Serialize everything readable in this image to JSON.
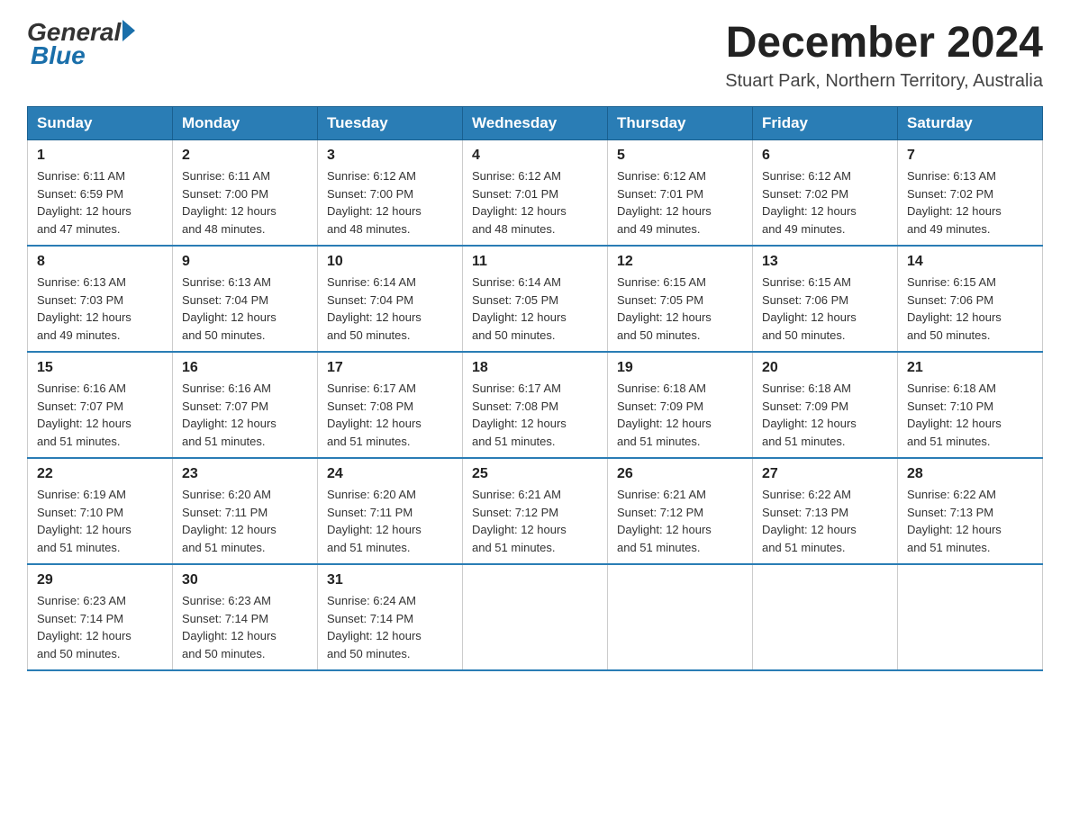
{
  "logo": {
    "general": "General",
    "blue": "Blue"
  },
  "title": "December 2024",
  "subtitle": "Stuart Park, Northern Territory, Australia",
  "days_of_week": [
    "Sunday",
    "Monday",
    "Tuesday",
    "Wednesday",
    "Thursday",
    "Friday",
    "Saturday"
  ],
  "weeks": [
    [
      {
        "day": "1",
        "sunrise": "6:11 AM",
        "sunset": "6:59 PM",
        "daylight": "12 hours and 47 minutes."
      },
      {
        "day": "2",
        "sunrise": "6:11 AM",
        "sunset": "7:00 PM",
        "daylight": "12 hours and 48 minutes."
      },
      {
        "day": "3",
        "sunrise": "6:12 AM",
        "sunset": "7:00 PM",
        "daylight": "12 hours and 48 minutes."
      },
      {
        "day": "4",
        "sunrise": "6:12 AM",
        "sunset": "7:01 PM",
        "daylight": "12 hours and 48 minutes."
      },
      {
        "day": "5",
        "sunrise": "6:12 AM",
        "sunset": "7:01 PM",
        "daylight": "12 hours and 49 minutes."
      },
      {
        "day": "6",
        "sunrise": "6:12 AM",
        "sunset": "7:02 PM",
        "daylight": "12 hours and 49 minutes."
      },
      {
        "day": "7",
        "sunrise": "6:13 AM",
        "sunset": "7:02 PM",
        "daylight": "12 hours and 49 minutes."
      }
    ],
    [
      {
        "day": "8",
        "sunrise": "6:13 AM",
        "sunset": "7:03 PM",
        "daylight": "12 hours and 49 minutes."
      },
      {
        "day": "9",
        "sunrise": "6:13 AM",
        "sunset": "7:04 PM",
        "daylight": "12 hours and 50 minutes."
      },
      {
        "day": "10",
        "sunrise": "6:14 AM",
        "sunset": "7:04 PM",
        "daylight": "12 hours and 50 minutes."
      },
      {
        "day": "11",
        "sunrise": "6:14 AM",
        "sunset": "7:05 PM",
        "daylight": "12 hours and 50 minutes."
      },
      {
        "day": "12",
        "sunrise": "6:15 AM",
        "sunset": "7:05 PM",
        "daylight": "12 hours and 50 minutes."
      },
      {
        "day": "13",
        "sunrise": "6:15 AM",
        "sunset": "7:06 PM",
        "daylight": "12 hours and 50 minutes."
      },
      {
        "day": "14",
        "sunrise": "6:15 AM",
        "sunset": "7:06 PM",
        "daylight": "12 hours and 50 minutes."
      }
    ],
    [
      {
        "day": "15",
        "sunrise": "6:16 AM",
        "sunset": "7:07 PM",
        "daylight": "12 hours and 51 minutes."
      },
      {
        "day": "16",
        "sunrise": "6:16 AM",
        "sunset": "7:07 PM",
        "daylight": "12 hours and 51 minutes."
      },
      {
        "day": "17",
        "sunrise": "6:17 AM",
        "sunset": "7:08 PM",
        "daylight": "12 hours and 51 minutes."
      },
      {
        "day": "18",
        "sunrise": "6:17 AM",
        "sunset": "7:08 PM",
        "daylight": "12 hours and 51 minutes."
      },
      {
        "day": "19",
        "sunrise": "6:18 AM",
        "sunset": "7:09 PM",
        "daylight": "12 hours and 51 minutes."
      },
      {
        "day": "20",
        "sunrise": "6:18 AM",
        "sunset": "7:09 PM",
        "daylight": "12 hours and 51 minutes."
      },
      {
        "day": "21",
        "sunrise": "6:18 AM",
        "sunset": "7:10 PM",
        "daylight": "12 hours and 51 minutes."
      }
    ],
    [
      {
        "day": "22",
        "sunrise": "6:19 AM",
        "sunset": "7:10 PM",
        "daylight": "12 hours and 51 minutes."
      },
      {
        "day": "23",
        "sunrise": "6:20 AM",
        "sunset": "7:11 PM",
        "daylight": "12 hours and 51 minutes."
      },
      {
        "day": "24",
        "sunrise": "6:20 AM",
        "sunset": "7:11 PM",
        "daylight": "12 hours and 51 minutes."
      },
      {
        "day": "25",
        "sunrise": "6:21 AM",
        "sunset": "7:12 PM",
        "daylight": "12 hours and 51 minutes."
      },
      {
        "day": "26",
        "sunrise": "6:21 AM",
        "sunset": "7:12 PM",
        "daylight": "12 hours and 51 minutes."
      },
      {
        "day": "27",
        "sunrise": "6:22 AM",
        "sunset": "7:13 PM",
        "daylight": "12 hours and 51 minutes."
      },
      {
        "day": "28",
        "sunrise": "6:22 AM",
        "sunset": "7:13 PM",
        "daylight": "12 hours and 51 minutes."
      }
    ],
    [
      {
        "day": "29",
        "sunrise": "6:23 AM",
        "sunset": "7:14 PM",
        "daylight": "12 hours and 50 minutes."
      },
      {
        "day": "30",
        "sunrise": "6:23 AM",
        "sunset": "7:14 PM",
        "daylight": "12 hours and 50 minutes."
      },
      {
        "day": "31",
        "sunrise": "6:24 AM",
        "sunset": "7:14 PM",
        "daylight": "12 hours and 50 minutes."
      },
      null,
      null,
      null,
      null
    ]
  ],
  "labels": {
    "sunrise_prefix": "Sunrise: ",
    "sunset_prefix": "Sunset: ",
    "daylight_prefix": "Daylight: "
  }
}
